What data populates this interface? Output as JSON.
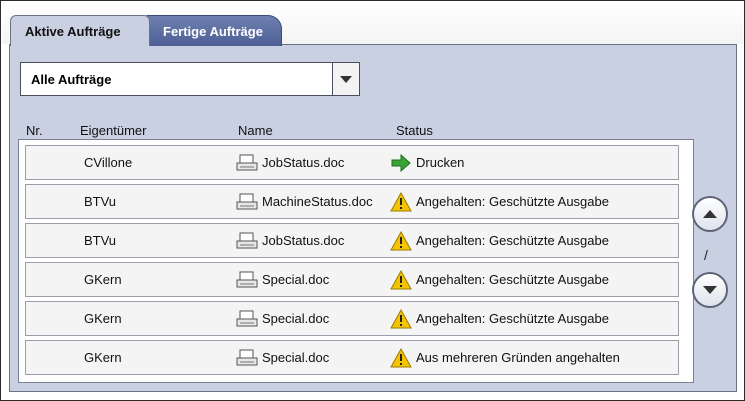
{
  "tabs": [
    {
      "label": "Aktive Aufträge",
      "active": true
    },
    {
      "label": "Fertige Aufträge",
      "active": false
    }
  ],
  "filter": {
    "value": "Alle Aufträge"
  },
  "columns": {
    "nr": "Nr.",
    "owner": "Eigentümer",
    "name": "Name",
    "status": "Status"
  },
  "rows": [
    {
      "owner": "CVillone",
      "name": "JobStatus.doc",
      "status": "Drucken",
      "status_icon": "arrow-right-icon"
    },
    {
      "owner": "BTVu",
      "name": "MachineStatus.doc",
      "status": "Angehalten: Geschützte Ausgabe",
      "status_icon": "warning-icon"
    },
    {
      "owner": "BTVu",
      "name": "JobStatus.doc",
      "status": "Angehalten: Geschützte Ausgabe",
      "status_icon": "warning-icon"
    },
    {
      "owner": "GKern",
      "name": "Special.doc",
      "status": "Angehalten: Geschützte Ausgabe",
      "status_icon": "warning-icon"
    },
    {
      "owner": "GKern",
      "name": "Special.doc",
      "status": "Angehalten: Geschützte Ausgabe",
      "status_icon": "warning-icon"
    },
    {
      "owner": "GKern",
      "name": "Special.doc",
      "status": "Aus mehreren Gründen angehalten",
      "status_icon": "warning-icon"
    }
  ],
  "pager": {
    "separator": "/"
  },
  "colors": {
    "panel": "#c9d0e2",
    "tab_inactive": "#5b6ba0",
    "green_arrow": "#3aa335",
    "warning": "#f5c400"
  }
}
